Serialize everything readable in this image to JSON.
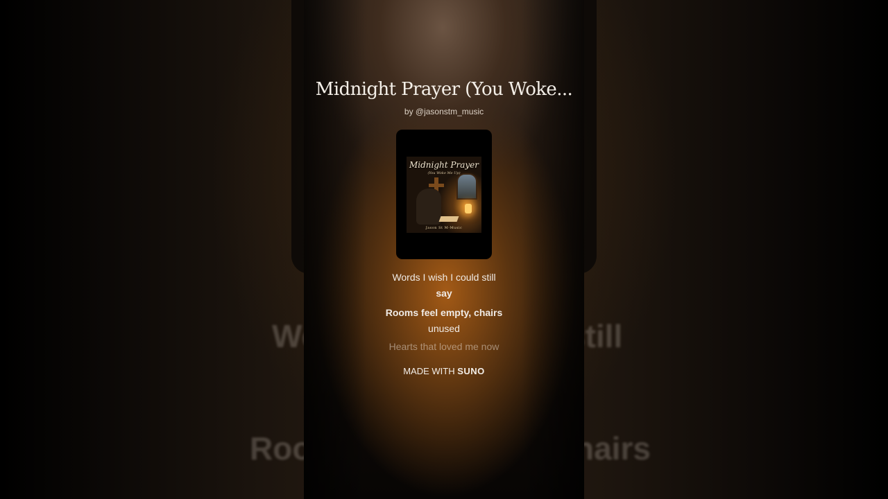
{
  "video": {
    "title": "Midnight Prayer (You Woke...",
    "byline": "by @jasonstm_music"
  },
  "cover": {
    "title": "Midnight Prayer",
    "subtitle": "(You Woke Me Up)",
    "artist": "Jason St M-Music"
  },
  "lyrics": [
    {
      "plain": "Words I wish I could still",
      "strong": "say"
    },
    {
      "strong": "Rooms feel empty, chairs",
      "plain": "unused"
    },
    {
      "plain": "Hearts that loved me now"
    }
  ],
  "footer": {
    "prefix": "MADE WITH",
    "brand": "SUNO"
  },
  "background": {
    "lyric_1_left": "Wo",
    "lyric_1_right": "still",
    "lyric_2_left": "Roo",
    "lyric_2_right": "hairs"
  },
  "colors": {
    "accent_glow": "#a35a16",
    "text": "#f0ebe6"
  }
}
